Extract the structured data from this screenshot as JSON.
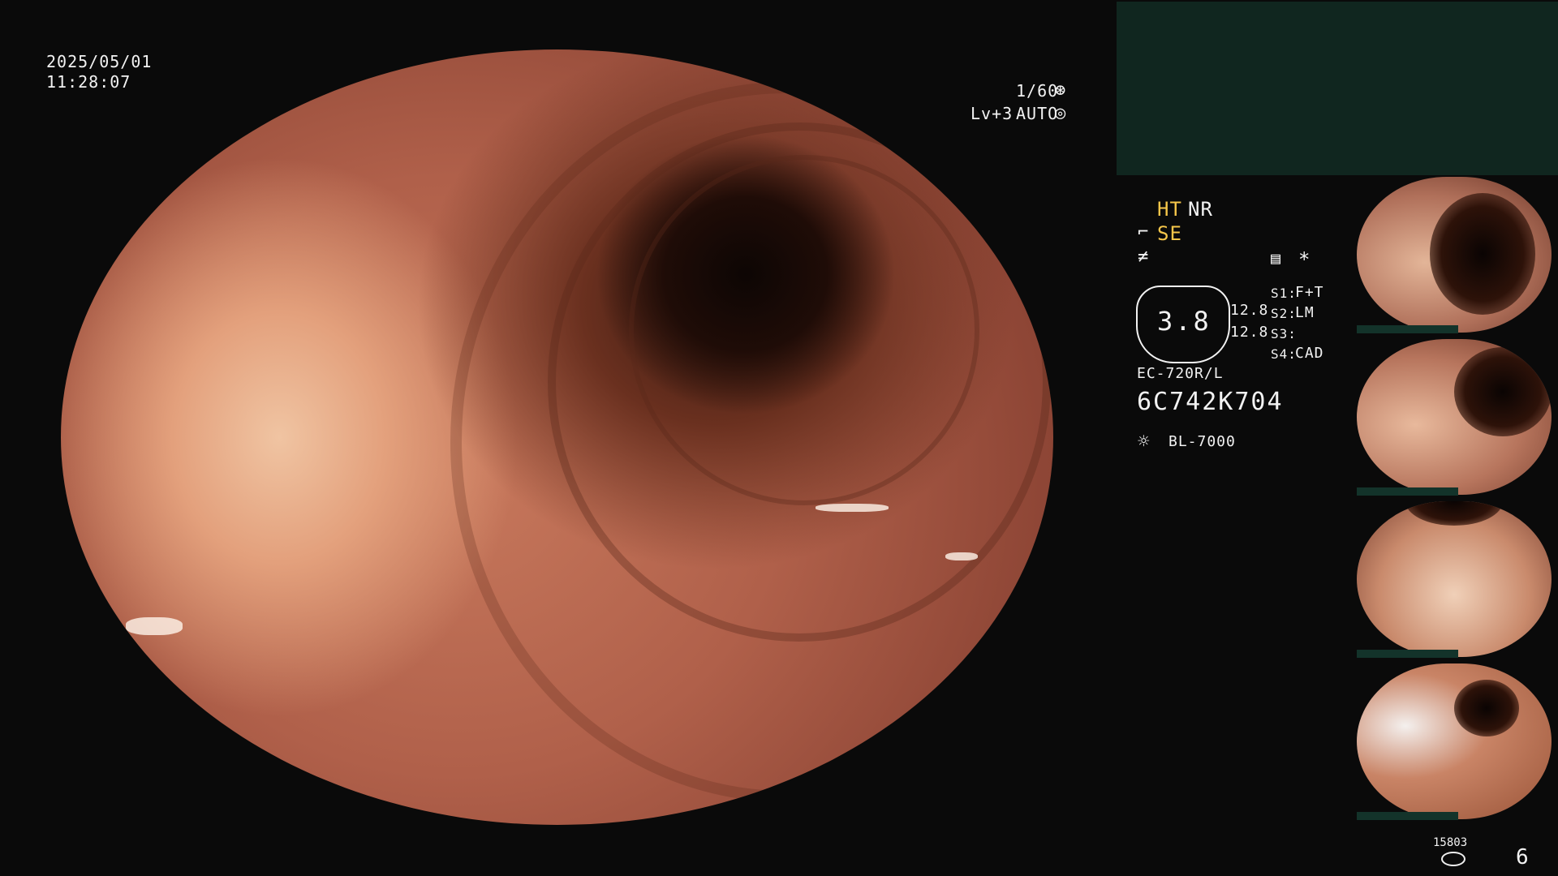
{
  "overlay": {
    "date": "2025/05/01",
    "time": "11:28:07",
    "shutter": "1/60",
    "level": "Lv+3",
    "exposure_mode": "AUTO"
  },
  "settings": {
    "ht": "HT",
    "nr": "NR",
    "se": "SE",
    "star": "*",
    "zoom_value": "3.8",
    "values": [
      "12.8",
      "12.8"
    ],
    "switches": [
      {
        "label": "S1:",
        "value": "F+T"
      },
      {
        "label": "S2:",
        "value": "LM"
      },
      {
        "label": "S3:",
        "value": ""
      },
      {
        "label": "S4:",
        "value": "CAD"
      }
    ]
  },
  "scope": {
    "model": "EC-720R/L",
    "serial": "6C742K704",
    "light_source": "BL-7000"
  },
  "footer": {
    "counter": "15803",
    "image_count": "6"
  },
  "icons": {
    "shutter": "aperture-icon",
    "auto": "auto-exposure-icon",
    "light": "sun-icon",
    "record": "disk-icon"
  },
  "colors": {
    "accent_yellow": "#f6c64a",
    "panel_green": "#10261f"
  }
}
